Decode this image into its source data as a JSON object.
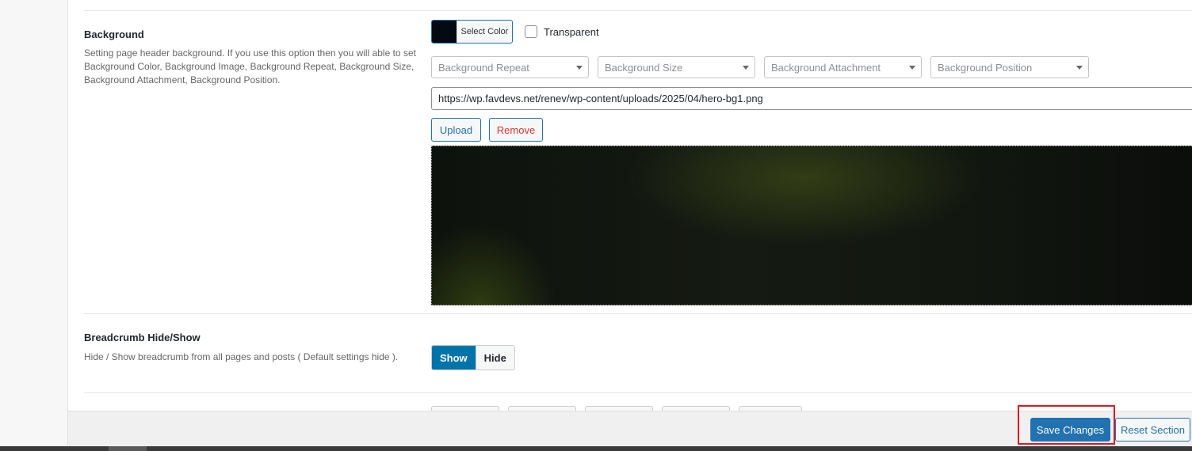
{
  "background_field": {
    "title": "Background",
    "description": "Setting page header background. If you use this option then you will able to set Background Color, Background Image, Background Repeat, Background Size, Background Attachment, Background Position.",
    "color_button_label": "Select Color",
    "selected_color": "#050a12",
    "transparent_label": "Transparent",
    "transparent_checked": false,
    "selects": [
      {
        "placeholder": "Background Repeat"
      },
      {
        "placeholder": "Background Size"
      },
      {
        "placeholder": "Background Attachment"
      },
      {
        "placeholder": "Background Position"
      }
    ],
    "image_url": "https://wp.favdevs.net/renev/wp-content/uploads/2025/04/hero-bg1.png",
    "upload_label": "Upload",
    "remove_label": "Remove"
  },
  "breadcrumb_field": {
    "title": "Breadcrumb Hide/Show",
    "description": "Hide / Show breadcrumb from all pages and posts ( Default settings hide ).",
    "options": [
      "Show",
      "Hide"
    ],
    "selected": "Show"
  },
  "footer": {
    "save_label": "Save Changes",
    "reset_label": "Reset Section"
  },
  "colors": {
    "primary": "#2271b1",
    "toggle_active": "#0073aa",
    "remove_text": "#d63638",
    "highlight": "#e0161e"
  }
}
